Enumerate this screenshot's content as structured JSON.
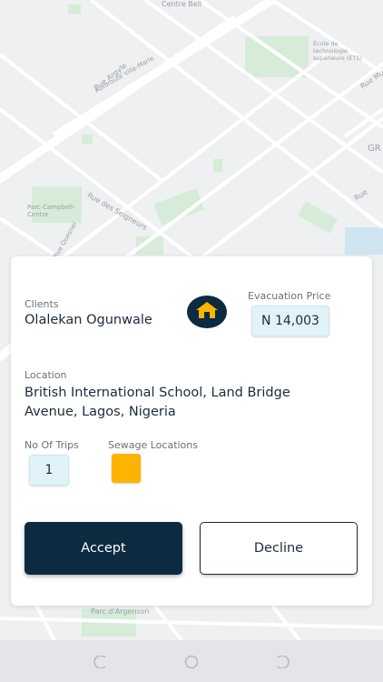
{
  "map": {
    "labels": {
      "centre_bell": "Centre Bell",
      "rue_argyle": "Rue Argyle",
      "autoroute": "Autoroute Ville-Marie",
      "ecole": "École de technologie supérieure (ETS)",
      "rue_mur": "Rue Mur",
      "gr": "GR",
      "parc_campbell": "Parc Campbell-Centre",
      "rue_seigneurs": "Rue des Seigneurs",
      "rue_quesnel": "Rue Quesnel",
      "parc_argenson": "Parc d'Argenson",
      "rue": "Rue"
    }
  },
  "request": {
    "clients_label": "Clients",
    "client_name": "Olalekan Ogunwale",
    "price_label": "Evacuation Price",
    "price_value": "N 14,003",
    "location_label": "Location",
    "location_line1": "British International School, Land Bridge",
    "location_line2": "Avenue, Lagos, Nigeria",
    "trips_label": "No Of Trips",
    "trips_value": "1",
    "sewage_label": "Sewage Locations",
    "sewage_color": "#fcb400",
    "accept_label": "Accept",
    "decline_label": "Decline",
    "client_icon": "house-icon"
  },
  "navbar": {
    "icons": [
      "back-icon",
      "home-icon",
      "recents-icon"
    ]
  }
}
